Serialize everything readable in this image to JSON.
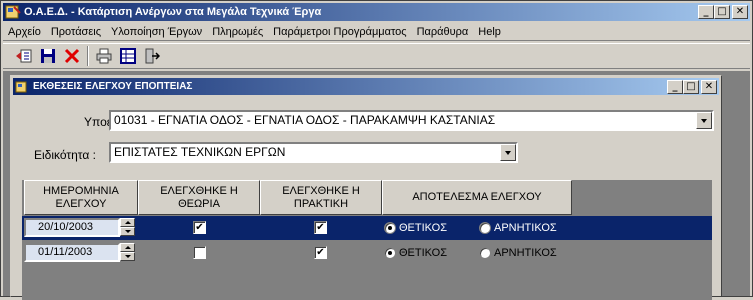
{
  "window": {
    "title": "Ο.Α.Ε.Δ. - Κατάρτιση Ανέργων στα Μεγάλα Τεχνικά Έργα",
    "min": "_",
    "max": "□",
    "close": "✕"
  },
  "menu": [
    "Αρχείο",
    "Προτάσεις",
    "Υλοποίηση Έργων",
    "Πληρωμές",
    "Παράμετροι Προγράμματος",
    "Παράθυρα",
    "Help"
  ],
  "toolbar": [
    "new-record-icon",
    "save-icon",
    "delete-icon",
    "print-icon",
    "grid-view-icon",
    "exit-icon"
  ],
  "child": {
    "title": "ΕΚΘΕΣΕΙΣ ΕΛΕΓΧΟΥ ΕΠΟΠΤΕΙΑΣ",
    "min": "_",
    "max": "□",
    "close": "✕"
  },
  "form": {
    "subproject_label": "Υποέργο :",
    "subproject_value": "01031 - ΕΓΝΑΤΙΑ ΟΔΟΣ - ΕΓΝΑΤΙΑ ΟΔΟΣ - ΠΑΡΑΚΑΜΨΗ ΚΑΣΤΑΝΙΑΣ",
    "specialty_label": "Ειδικότητα :",
    "specialty_value": "ΕΠΙΣΤΑΤΕΣ ΤΕΧΝΙΚΩΝ ΕΡΓΩΝ"
  },
  "grid": {
    "headers": [
      "ΗΜΕΡΟΜΗΝΙΑ ΕΛΕΓΧΟΥ",
      "ΕΛΕΓΧΘΗΚΕ Η ΘΕΩΡΙΑ",
      "ΕΛΕΓΧΘΗΚΕ Η ΠΡΑΚΤΙΚΗ",
      "ΑΠΟΤΕΛΕΣΜΑ ΕΛΕΓΧΟΥ"
    ],
    "positive_label": "ΘΕΤΙΚΟΣ",
    "negative_label": "ΑΡΝΗΤΙΚΟΣ",
    "rows": [
      {
        "date": "20/10/2003",
        "theory": "✔",
        "practice": "✔",
        "result": "ΘΕΤΙΚΟΣ"
      },
      {
        "date": "01/11/2003",
        "theory": "",
        "practice": "✔",
        "result": "ΘΕΤΙΚΟΣ"
      }
    ]
  },
  "colors": {
    "title_start": "#0a246a",
    "title_end": "#a6caf0",
    "selected_row": "#0a246a",
    "face": "#d4d0c8"
  }
}
